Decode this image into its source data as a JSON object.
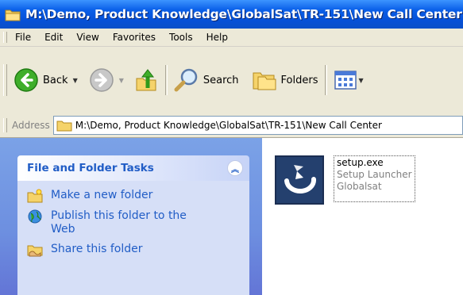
{
  "window": {
    "title": "M:\\Demo, Product Knowledge\\GlobalSat\\TR-151\\New Call Center"
  },
  "menu": [
    "File",
    "Edit",
    "View",
    "Favorites",
    "Tools",
    "Help"
  ],
  "toolbar": {
    "back_label": "Back",
    "search_label": "Search",
    "folders_label": "Folders"
  },
  "address": {
    "label": "Address",
    "path": "M:\\Demo, Product Knowledge\\GlobalSat\\TR-151\\New Call Center"
  },
  "task_pane": {
    "heading": "File and Folder Tasks",
    "tasks": [
      {
        "label": "Make a new folder",
        "icon": "new-folder-icon"
      },
      {
        "label": "Publish this folder to the Web",
        "icon": "publish-web-icon"
      },
      {
        "label": "Share this folder",
        "icon": "share-folder-icon"
      }
    ]
  },
  "files": [
    {
      "name": "setup.exe",
      "description": "Setup Launcher",
      "company": "Globalsat",
      "icon": "setup-launcher-icon"
    }
  ],
  "colors": {
    "title_bar": "#0a5fe8",
    "task_link": "#215dc6",
    "task_pane_bg": "#6d8fe0"
  }
}
